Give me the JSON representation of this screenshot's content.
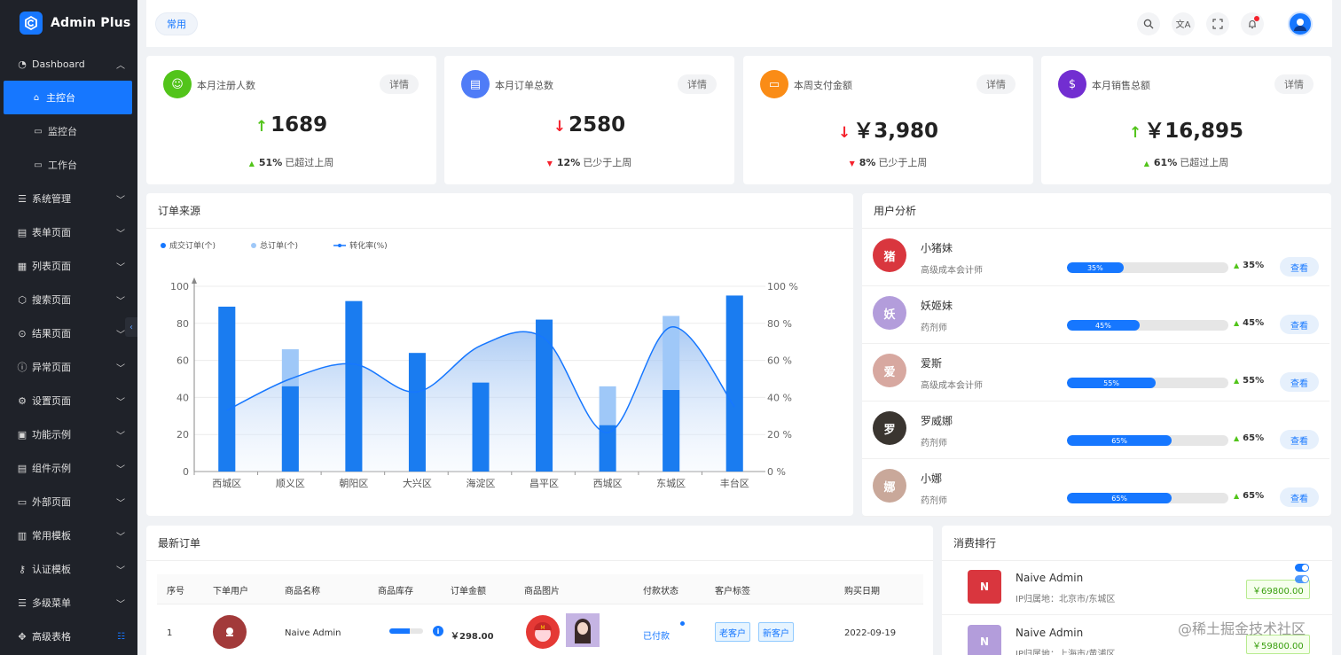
{
  "brand": {
    "title": "Admin Plus"
  },
  "sidebar": {
    "dashboard": {
      "label": "Dashboard"
    },
    "sub_items": [
      {
        "label": "主控台",
        "active": true,
        "icon": "home-icon"
      },
      {
        "label": "监控台",
        "active": false,
        "icon": "monitor-icon"
      },
      {
        "label": "工作台",
        "active": false,
        "icon": "desktop-icon"
      }
    ],
    "items": [
      {
        "label": "系统管理",
        "icon": "sliders-icon"
      },
      {
        "label": "表单页面",
        "icon": "form-icon"
      },
      {
        "label": "列表页面",
        "icon": "grid-icon"
      },
      {
        "label": "搜索页面",
        "icon": "cube-icon"
      },
      {
        "label": "结果页面",
        "icon": "check-circle-icon"
      },
      {
        "label": "异常页面",
        "icon": "warning-icon"
      },
      {
        "label": "设置页面",
        "icon": "gear-icon"
      },
      {
        "label": "功能示例",
        "icon": "function-icon"
      },
      {
        "label": "组件示例",
        "icon": "component-icon"
      },
      {
        "label": "外部页面",
        "icon": "external-icon"
      },
      {
        "label": "常用模板",
        "icon": "template-icon"
      },
      {
        "label": "认证模板",
        "icon": "key-icon"
      },
      {
        "label": "多级菜单",
        "icon": "menu-icon"
      },
      {
        "label": "高级表格",
        "icon": "table-icon"
      }
    ]
  },
  "header": {
    "tag": "常用"
  },
  "stats": [
    {
      "title": "本月注册人数",
      "detail": "详情",
      "value": "1689",
      "direction": "up",
      "percent": "51%",
      "note": "已超过上周",
      "color": "#52c41a"
    },
    {
      "title": "本月订单总数",
      "detail": "详情",
      "value": "2580",
      "direction": "down",
      "percent": "12%",
      "note": "已少于上周",
      "color": "#4f7cf7"
    },
    {
      "title": "本周支付金额",
      "detail": "详情",
      "value": "￥3,980",
      "direction": "down",
      "percent": "8%",
      "note": "已少于上周",
      "color": "#fa8c16"
    },
    {
      "title": "本月销售总额",
      "detail": "详情",
      "value": "￥16,895",
      "direction": "up",
      "percent": "61%",
      "note": "已超过上周",
      "color": "#722ed1"
    }
  ],
  "order_panel": {
    "title": "订单来源"
  },
  "chart_data": {
    "type": "bar",
    "categories": [
      "西城区",
      "顺义区",
      "朝阳区",
      "大兴区",
      "海淀区",
      "昌平区",
      "西城区",
      "东城区",
      "丰台区"
    ],
    "series": [
      {
        "name": "成交订单(个)",
        "type": "bar",
        "values": [
          89,
          46,
          92,
          64,
          48,
          82,
          25,
          44,
          95
        ]
      },
      {
        "name": "总订单(个)",
        "type": "bar",
        "values": [
          89,
          66,
          92,
          64,
          48,
          82,
          46,
          84,
          95
        ]
      },
      {
        "name": "转化率(%)",
        "type": "area",
        "values": [
          33,
          50,
          58,
          43,
          68,
          72,
          21,
          78,
          35
        ]
      }
    ],
    "y_ticks": [
      "0",
      "20",
      "40",
      "60",
      "80",
      "100"
    ],
    "y2_ticks": [
      "0 %",
      "20 %",
      "40 %",
      "60 %",
      "80 %",
      "100 %"
    ],
    "ylim": [
      0,
      100
    ],
    "y2lim": [
      0,
      100
    ],
    "grid": true,
    "legend": "top-left"
  },
  "user_panel": {
    "title": "用户分析",
    "view_label": "查看",
    "users": [
      {
        "name": "小猪妹",
        "role": "高级成本会计师",
        "progress": 35,
        "progress_label": "35%",
        "pct": "35%",
        "avatar_color": "#d9363e",
        "avatar_char": "猪"
      },
      {
        "name": "妖姬妹",
        "role": "药剂师",
        "progress": 45,
        "progress_label": "45%",
        "pct": "45%",
        "avatar_color": "#b39ddb",
        "avatar_char": "妖"
      },
      {
        "name": "爱斯",
        "role": "高级成本会计师",
        "progress": 55,
        "progress_label": "55%",
        "pct": "55%",
        "avatar_color": "#d7a8a0",
        "avatar_char": "爱"
      },
      {
        "name": "罗威娜",
        "role": "药剂师",
        "progress": 65,
        "progress_label": "65%",
        "pct": "65%",
        "avatar_color": "#3a3530",
        "avatar_char": "罗"
      },
      {
        "name": "小娜",
        "role": "药剂师",
        "progress": 65,
        "progress_label": "65%",
        "pct": "65%",
        "avatar_color": "#c9a89a",
        "avatar_char": "娜"
      }
    ]
  },
  "latest_orders": {
    "title": "最新订单",
    "columns": [
      "序号",
      "下单用户",
      "商品名称",
      "商品库存",
      "订单金额",
      "商品图片",
      "付款状态",
      "客户标签",
      "购买日期"
    ],
    "rows": [
      {
        "index": "1",
        "product": "Naive Admin",
        "stock": 60,
        "amount": "￥298.00",
        "pay_status": "已付款",
        "tags": [
          "老客户",
          "新客户"
        ],
        "date": "2022-09-19"
      }
    ]
  },
  "ranking": {
    "title": "消费排行",
    "items": [
      {
        "name": "Naive Admin",
        "location": "IP归属地：北京市/东城区",
        "amount": "￥69800.00",
        "avatar_color": "#d9363e"
      },
      {
        "name": "Naive Admin",
        "location": "IP归属地：上海市/黄浦区",
        "amount": "￥59800.00",
        "avatar_color": "#b39ddb"
      }
    ]
  },
  "watermark": "@稀土掘金技术社区"
}
